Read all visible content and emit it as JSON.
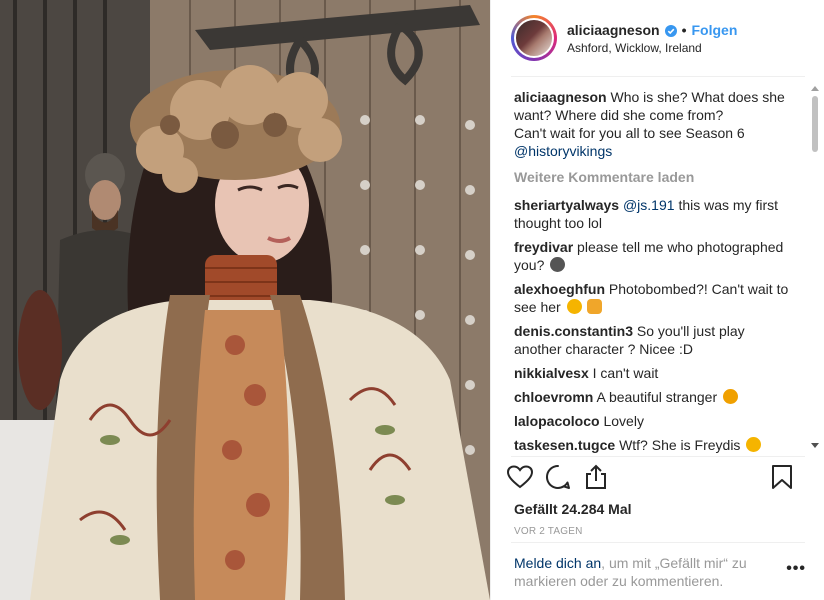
{
  "header": {
    "username": "aliciaagneson",
    "separator": "•",
    "follow_label": "Folgen",
    "location": "Ashford, Wicklow, Ireland"
  },
  "caption": {
    "username": "aliciaagneson",
    "line1": "Who is she? What does she want? Where did she come from?",
    "line2": "Can't wait for you all to see Season 6",
    "mention": "@historyvikings"
  },
  "load_more_label": "Weitere Kommentare laden",
  "comments": [
    {
      "user": "sheriartyalways",
      "mention": "@js.191",
      "text": "this was my first thought too lol"
    },
    {
      "user": "freydivar",
      "text": "please tell me who photographed you?"
    },
    {
      "user": "alexhoeghfun",
      "text": "Photobombed?! Can't wait to see her"
    },
    {
      "user": "denis.constantin3",
      "text": "So you'll just play another character ? Nicee :D"
    },
    {
      "user": "nikkialvesx",
      "text": "I can't wait"
    },
    {
      "user": "chloevromn",
      "text": "A beautiful stranger"
    },
    {
      "user": "lalopacoloco",
      "text": "Lovely"
    },
    {
      "user": "taskesen.tugce",
      "text": "Wtf? She is Freydis"
    }
  ],
  "icons": {
    "verified": "verified-badge-icon",
    "like": "heart-icon",
    "comment": "speech-bubble-icon",
    "share": "share-icon",
    "save": "bookmark-icon",
    "more": "more-options-icon"
  },
  "likes_text": "Gefällt 24.284 Mal",
  "age_text": "VOR 2 TAGEN",
  "footer": {
    "login_link": "Melde dich an",
    "text": ", um mit „Gefällt mir“ zu markieren oder zu kommentieren.",
    "more_label": "•••"
  },
  "colors": {
    "accent": "#3897f0",
    "link": "#003569",
    "muted": "#999999"
  }
}
